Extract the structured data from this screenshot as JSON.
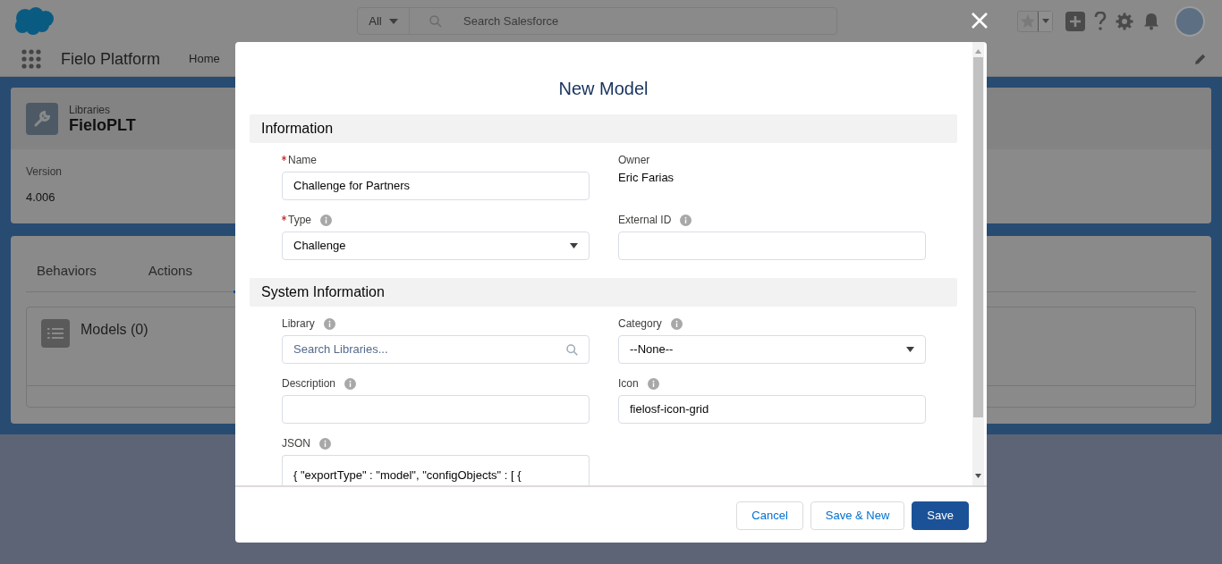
{
  "global_header": {
    "search_scope": "All",
    "search_placeholder": "Search Salesforce"
  },
  "nav": {
    "app_name": "Fielo Platform",
    "items": [
      "Home"
    ]
  },
  "record": {
    "object_label": "Libraries",
    "name": "FieloPLT",
    "fields": [
      {
        "label": "Version",
        "value": "4.006"
      }
    ]
  },
  "related": {
    "tabs": [
      {
        "label": "Behaviors",
        "selected": false
      },
      {
        "label": "Actions",
        "selected": false
      }
    ],
    "list_title": "Models (0)"
  },
  "modal": {
    "title": "New Model",
    "sections": [
      {
        "title": "Information",
        "fields": [
          {
            "kind": "text",
            "label": "Name",
            "required": true,
            "info": false,
            "value": "Challenge for Partners"
          },
          {
            "kind": "readonly",
            "label": "Owner",
            "required": false,
            "info": false,
            "value": "Eric Farias"
          },
          {
            "kind": "select",
            "label": "Type",
            "required": true,
            "info": true,
            "value": "Challenge"
          },
          {
            "kind": "text",
            "label": "External ID",
            "required": false,
            "info": true
          }
        ]
      },
      {
        "title": "System Information",
        "fields": [
          {
            "kind": "lookup",
            "label": "Library",
            "required": false,
            "info": true,
            "placeholder": "Search Libraries..."
          },
          {
            "kind": "select",
            "label": "Category",
            "required": false,
            "info": true,
            "value": "--None--"
          },
          {
            "kind": "text",
            "label": "Description",
            "required": false,
            "info": true
          },
          {
            "kind": "text",
            "label": "Icon",
            "required": false,
            "info": true,
            "value": "fielosf-icon-grid"
          },
          {
            "kind": "textarea",
            "label": "JSON",
            "required": false,
            "info": true,
            "value": "{ \"exportType\" : \"model\", \"configObjects\" : [ {"
          }
        ]
      }
    ],
    "buttons": [
      {
        "label": "Cancel",
        "kind": "neutral"
      },
      {
        "label": "Save & New",
        "kind": "neutral"
      },
      {
        "label": "Save",
        "kind": "brand"
      }
    ]
  }
}
